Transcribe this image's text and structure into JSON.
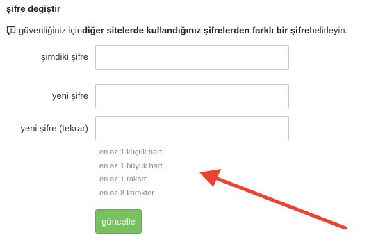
{
  "form": {
    "title": "şifre değiştir",
    "notice": {
      "icon": "exclamation-speech-icon",
      "prefix": "güvenliğiniz için ",
      "bold": "diğer sitelerde kullandığınız şifrelerden farklı bir şifre",
      "suffix": " belirleyin."
    },
    "fields": [
      {
        "label": "şimdiki şifre",
        "value": "",
        "placeholder": ""
      },
      {
        "label": "yeni şifre",
        "value": "",
        "placeholder": ""
      },
      {
        "label": "yeni şifre (tekrar)",
        "value": "",
        "placeholder": ""
      }
    ],
    "rules": [
      "en az 1 küçük harf",
      "en az 1 büyük harf",
      "en az 1 rakam",
      "en az 8 karakter"
    ],
    "submit_label": "güncelle"
  },
  "colors": {
    "button_bg": "#77c25c",
    "arrow": "#ef4131",
    "rule_text": "#8a8a8a"
  }
}
